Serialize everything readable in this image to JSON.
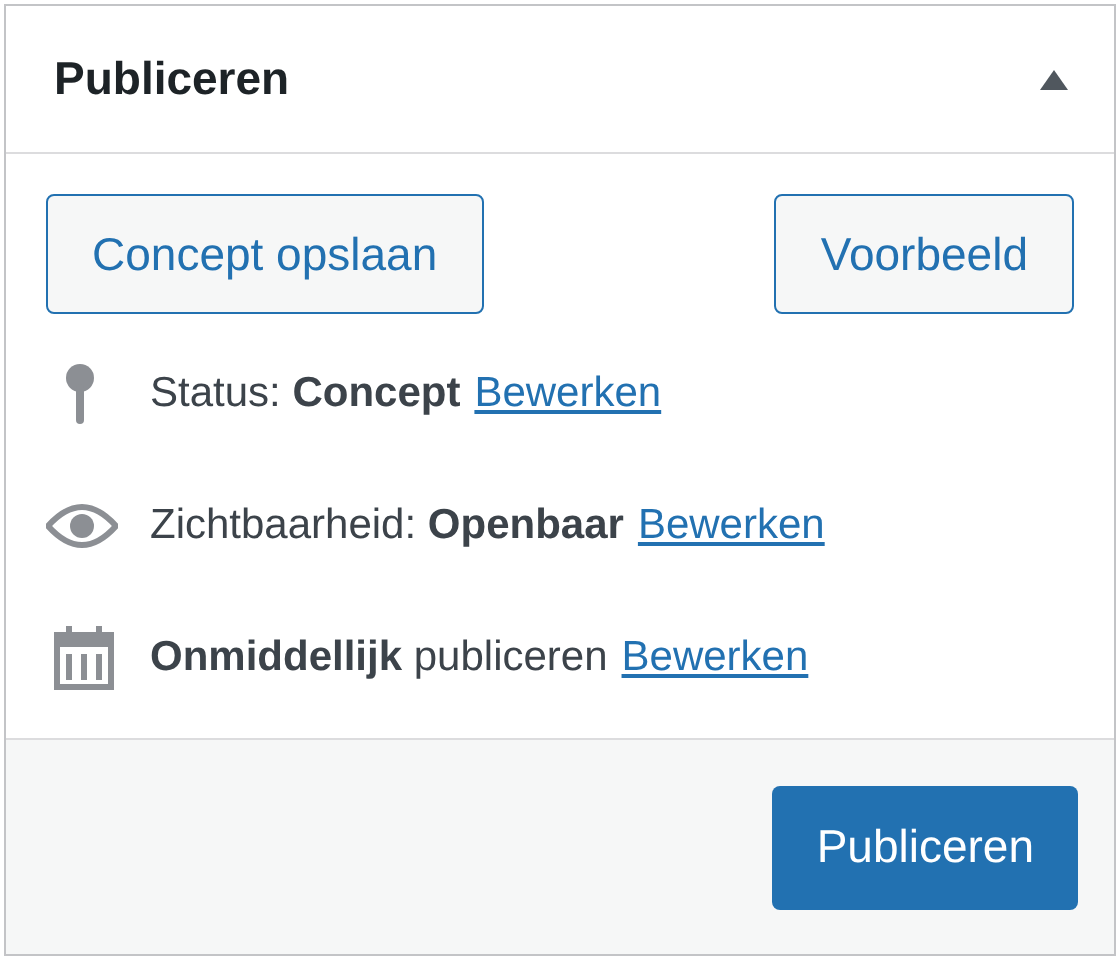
{
  "header": {
    "title": "Publiceren",
    "expanded": true
  },
  "actions": [
    {
      "label": "Concept opslaan"
    },
    {
      "label": "Voorbeeld"
    }
  ],
  "rows": [
    {
      "kind": "status",
      "text": "Status: **Concept**",
      "link": "Bewerken"
    },
    {
      "kind": "visibility",
      "text": "Zichtbaarheid: **Openbaar**",
      "link": "Bewerken"
    },
    {
      "kind": "schedule",
      "text": "**Onmiddellijk** publiceren",
      "link": "Bewerken"
    }
  ],
  "footer": {
    "button": "Publiceren"
  }
}
